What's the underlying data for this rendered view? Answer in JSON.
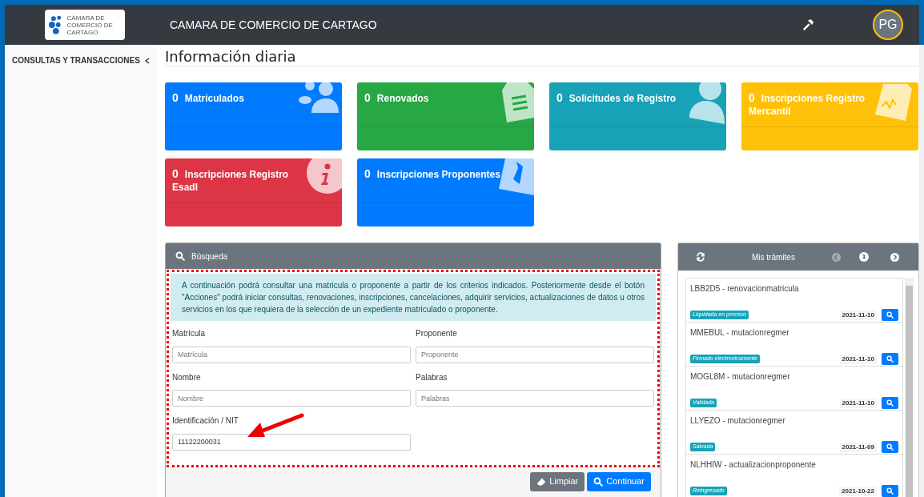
{
  "header": {
    "logo_text": "CÁMARA DE COMERCIO DE CARTAGO",
    "title": "CAMARA DE COMERCIO DE CARTAGO",
    "avatar": "PG"
  },
  "sidebar": {
    "items": [
      {
        "label": "CONSULTAS Y TRANSACCIONES",
        "expanded": false
      }
    ]
  },
  "page_title": "Información diaria",
  "cards": [
    {
      "count": "0",
      "label": "Matriculados",
      "color": "#007bff",
      "kind": "people"
    },
    {
      "count": "0",
      "label": "Renovados",
      "color": "#28a745",
      "kind": "document"
    },
    {
      "count": "0",
      "label": "Solicitudes de Registro",
      "color": "#17a2b8",
      "kind": "user"
    },
    {
      "count": "0",
      "label": "Inscripciones Registro Mercantil",
      "color": "#ffc107",
      "kind": "signature"
    },
    {
      "count": "0",
      "label": "Inscripciones Registro Esadl",
      "color": "#dc3545",
      "kind": "info"
    },
    {
      "count": "0",
      "label": "Inscripciones Proponentes",
      "color": "#007bff",
      "kind": "tie"
    }
  ],
  "search": {
    "title": "Búsqueda",
    "info": "A continuación podrá consultar una matricula o proponente a partir de los criterios indicados. Posteriormente desde el botón \"Acciones\" podrá iniciar consultas, renovaciones, inscripciones, cancelaciones, adquirir servicios, actualizaciones de datos u otros servicios en los que requiera de la selección de un expediente matriculado o proponente.",
    "fields": [
      {
        "label": "Matrícula",
        "placeholder": "Matrícula"
      },
      {
        "label": "Proponente",
        "placeholder": "Proponente"
      },
      {
        "label": "Nombre",
        "placeholder": "Nombre"
      },
      {
        "label": "Palabras",
        "placeholder": "Palabras"
      },
      {
        "label": "Identificación / NIT",
        "value": "11122200031"
      }
    ],
    "buttons": [
      {
        "label": "Limpiar",
        "kind": "clear"
      },
      {
        "label": "Continuar",
        "kind": "search"
      }
    ]
  },
  "tramites": {
    "title": "Mis trámites",
    "page": "1",
    "items": [
      {
        "title": "LBB2D5 - renovacionmatricula",
        "status": "Liquidada en proceso",
        "date": "2021-11-10"
      },
      {
        "title": "MMEBUL - mutacionregmer",
        "status": "Firmado electronicamente",
        "date": "2021-11-10"
      },
      {
        "title": "MOGL8M - mutacionregmer",
        "status": "Validada",
        "date": "2021-11-10"
      },
      {
        "title": "LLYEZO - mutacionregmer",
        "status": "Salvada",
        "date": "2021-11-09"
      },
      {
        "title": "NLHHIW - actualizacionproponente",
        "status": "Reingresado",
        "date": "2021-10-22"
      }
    ]
  }
}
